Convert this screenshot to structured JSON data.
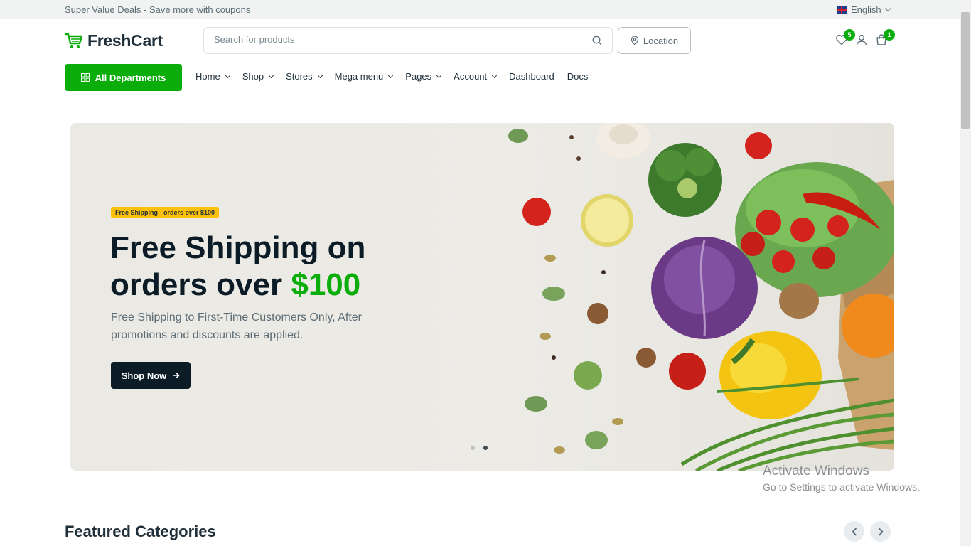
{
  "topbar": {
    "promo": "Super Value Deals - Save more with coupons",
    "language": "English"
  },
  "header": {
    "brand": "FreshCart",
    "search": {
      "placeholder": "Search for products"
    },
    "location_label": "Location",
    "wishlist_count": "5",
    "cart_count": "1",
    "departments_label": "All Departments",
    "nav": [
      {
        "label": "Home",
        "has_dropdown": true
      },
      {
        "label": "Shop",
        "has_dropdown": true
      },
      {
        "label": "Stores",
        "has_dropdown": true
      },
      {
        "label": "Mega menu",
        "has_dropdown": true
      },
      {
        "label": "Pages",
        "has_dropdown": true
      },
      {
        "label": "Account",
        "has_dropdown": true
      },
      {
        "label": "Dashboard",
        "has_dropdown": false
      },
      {
        "label": "Docs",
        "has_dropdown": false
      }
    ]
  },
  "hero": {
    "tag": "Free Shipping - orders over $100",
    "headline_line1": "Free Shipping on",
    "headline_line2_prefix": "orders over ",
    "headline_accent": "$100",
    "subtitle": "Free Shipping to First-Time Customers Only, After promotions and discounts are applied.",
    "cta": "Shop Now",
    "slides_total": 2,
    "active_slide": 2
  },
  "watermark": {
    "title": "Activate Windows",
    "subtitle": "Go to Settings to activate Windows."
  },
  "featured": {
    "title": "Featured Categories"
  },
  "colors": {
    "brand_green": "#0aad0a",
    "dark": "#0b1c26",
    "tag_yellow": "#ffc107",
    "topbar_bg": "#f0f3f2"
  },
  "icons": [
    "cart-logo-icon",
    "search-icon",
    "location-pin-icon",
    "heart-icon",
    "user-icon",
    "shopping-bag-icon",
    "grid-icon",
    "arrow-right-icon",
    "chevron-left-icon",
    "chevron-right-icon",
    "flag-uk-icon"
  ]
}
